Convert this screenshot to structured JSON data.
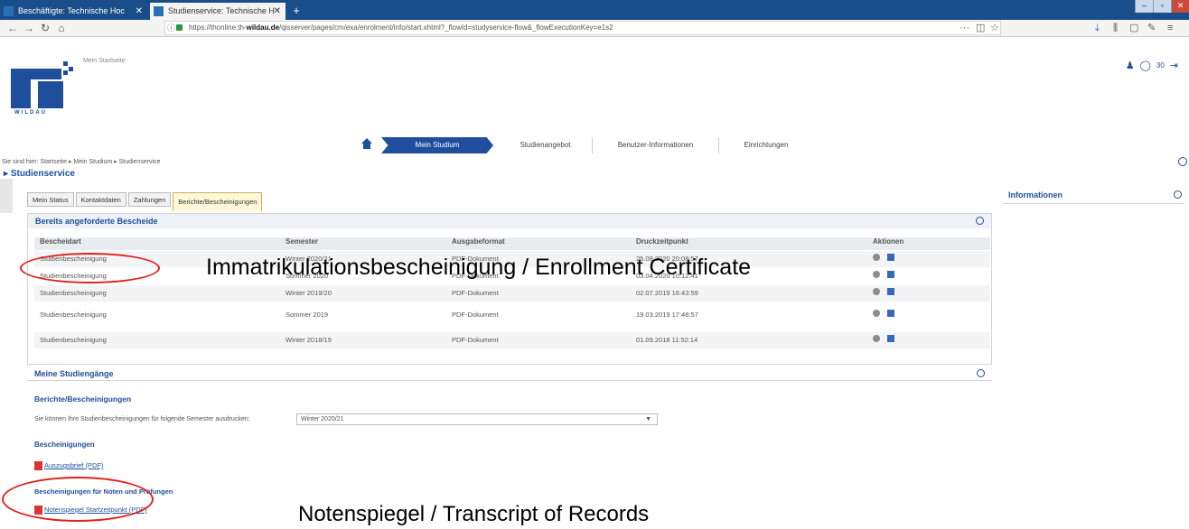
{
  "browser": {
    "tabs": [
      {
        "title": "Beschäftigte: Technische Hoc"
      },
      {
        "title": "Studienservice: Technische H"
      }
    ],
    "url_prefix": "https://thonline.th-",
    "url_host": "wildau.de",
    "url_rest": "/qisserver/pages/cm/exa/enrolment/info/start.xhtml?_flowId=studyservice-flow&_flowExecutionKey=e1s2",
    "notification_count": "30"
  },
  "site": {
    "logo_text": "WILDAU",
    "site_link": "Mein Startseite",
    "nav": {
      "active": "Mein Studium",
      "items": [
        "Studienangebot",
        "Benutzer-Informationen",
        "Einrichtungen"
      ]
    },
    "breadcrumb": "Sie sind hier: Startseite  ▸  Mein Studium  ▸  Studienservice",
    "section_title": "Studienservice"
  },
  "subtabs": [
    "Mein Status",
    "Kontaktdaten",
    "Zahlungen",
    "Berichte/Bescheinigungen"
  ],
  "requested_panel": {
    "title": "Bereits angeforderte Bescheide",
    "columns": [
      "Bescheidart",
      "Semester",
      "Ausgabeformat",
      "Druckzeitpunkt",
      "Aktionen"
    ],
    "rows": [
      {
        "type": "Studienbescheinigung",
        "semester": "Winter 2020/21",
        "format": "PDF-Dokument",
        "time": "25.08.2020 20:08:57"
      },
      {
        "type": "Studienbescheinigung",
        "semester": "Sommer 2020",
        "format": "PDF-Dokument",
        "time": "03.04.2020 10:12:41"
      },
      {
        "type": "Studienbescheinigung",
        "semester": "Winter 2019/20",
        "format": "PDF-Dokument",
        "time": "02.07.2019 16:43:59"
      },
      {
        "type": "Studienbescheinigung",
        "semester": "Sommer 2019",
        "format": "PDF-Dokument",
        "time": "19.03.2019 17:48:57"
      },
      {
        "type": "Studienbescheinigung",
        "semester": "Winter 2018/19",
        "format": "PDF-Dokument",
        "time": "01.09.2018 11:52:14"
      }
    ]
  },
  "info_panel": {
    "title": "Informationen"
  },
  "studiengaenge_title": "Meine Studiengänge",
  "reports": {
    "title": "Berichte/Bescheinigungen",
    "semester_label": "Sie können Ihre Studienbescheinigungen für folgende Semester ausdrucken:",
    "semester_value": "Winter 2020/21",
    "bescheinigungen_title": "Bescheinigungen",
    "link1": "Auszugsbrief (PDF)",
    "noten_title": "Bescheinigungen für Noten und Prüfungen",
    "link2": "Notenspiegel Startzeitpunkt (PDF)"
  },
  "annotations": {
    "enrollment": "Immatrikulationsbescheinigung / Enrollment Certificate",
    "transcript": "Notenspiegel / Transcript of Records",
    "highlight_color": "#e0211a"
  }
}
